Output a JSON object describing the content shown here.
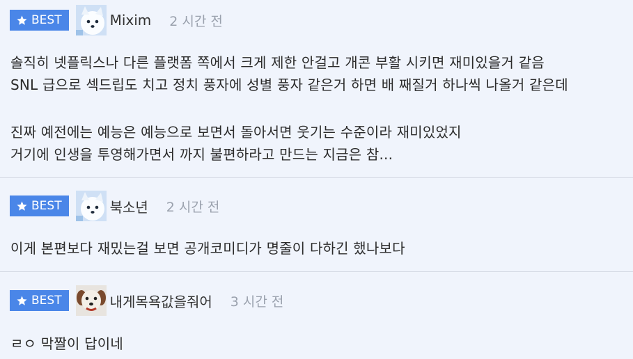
{
  "comments": [
    {
      "badge": "BEST",
      "username": "Mixim",
      "time": "2 시간 전",
      "avatar_icon": "white-dog-avatar",
      "lines": [
        "솔직히 넷플릭스나 다른 플랫폼 쪽에서 크게 제한 안걸고 개콘 부활 시키면 재미있을거 같음",
        "SNL 급으로 섹드립도 치고 정치 풍자에 성별 풍자 같은거 하면 배 째질거 하나씩 나올거 같은데",
        "",
        "진짜 예전에는 예능은 예능으로 보면서 돌아서면 웃기는 수준이라 재미있었지",
        "거기에 인생을 투영해가면서 까지 불편하라고 만드는 지금은 참..."
      ]
    },
    {
      "badge": "BEST",
      "username": "북소년",
      "time": "2 시간 전",
      "avatar_icon": "white-dog-avatar",
      "lines": [
        "이게 본편보다 재밌는걸 보면 공개코미디가 명줄이 다하긴 했나보다"
      ]
    },
    {
      "badge": "BEST",
      "username": "내게목욕값을줘어",
      "time": "3 시간 전",
      "avatar_icon": "puppy-face-avatar",
      "lines": [
        "ㄹㅇ 막짤이 답이네"
      ]
    }
  ],
  "colors": {
    "badge_bg": "#4a86e8",
    "page_bg": "#f0f4fc",
    "divider": "#d4d9e3",
    "time_text": "#9aa1ad"
  }
}
